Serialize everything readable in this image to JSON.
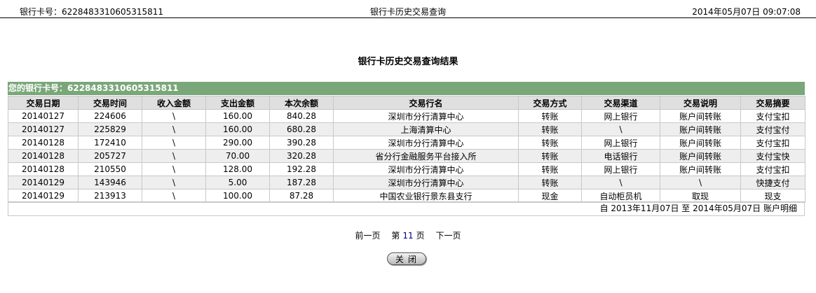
{
  "header": {
    "card_label": "银行卡号：6228483310605315811",
    "title": "银行卡历史交易查询",
    "datetime": "2014年05月07日 09:07:08"
  },
  "result_title": "银行卡历史交易查询结果",
  "card_bar": "您的银行卡号：6228483310605315811",
  "columns": [
    "交易日期",
    "交易时间",
    "收入金额",
    "支出金额",
    "本次余额",
    "交易行名",
    "交易方式",
    "交易渠道",
    "交易说明",
    "交易摘要"
  ],
  "rows": [
    [
      "20140127",
      "224606",
      "\\",
      "160.00",
      "840.28",
      "深圳市分行清算中心",
      "转账",
      "网上银行",
      "账户间转账",
      "支付宝扣"
    ],
    [
      "20140127",
      "225829",
      "\\",
      "160.00",
      "680.28",
      "上海清算中心",
      "转账",
      "\\",
      "账户间转账",
      "支付宝付"
    ],
    [
      "20140128",
      "172410",
      "\\",
      "290.00",
      "390.28",
      "深圳市分行清算中心",
      "转账",
      "网上银行",
      "账户间转账",
      "支付宝扣"
    ],
    [
      "20140128",
      "205727",
      "\\",
      "70.00",
      "320.28",
      "省分行金融服务平台接入所",
      "转账",
      "电话银行",
      "账户间转账",
      "支付宝快"
    ],
    [
      "20140128",
      "210550",
      "\\",
      "128.00",
      "192.28",
      "深圳市分行清算中心",
      "转账",
      "网上银行",
      "账户间转账",
      "支付宝扣"
    ],
    [
      "20140129",
      "143946",
      "\\",
      "5.00",
      "187.28",
      "深圳市分行清算中心",
      "转账",
      "\\",
      "\\",
      "快捷支付"
    ],
    [
      "20140129",
      "213913",
      "\\",
      "100.00",
      "87.28",
      "中国农业银行景东县支行",
      "现金",
      "自动柜员机",
      "取现",
      "现支"
    ]
  ],
  "summary": "自  2013年11月07日  至  2014年05月07日  账户明细",
  "pager": {
    "prev": "前一页",
    "page_prefix": "第",
    "page_number": "11",
    "page_suffix": "页",
    "next": "下一页"
  },
  "close_label": "关闭"
}
